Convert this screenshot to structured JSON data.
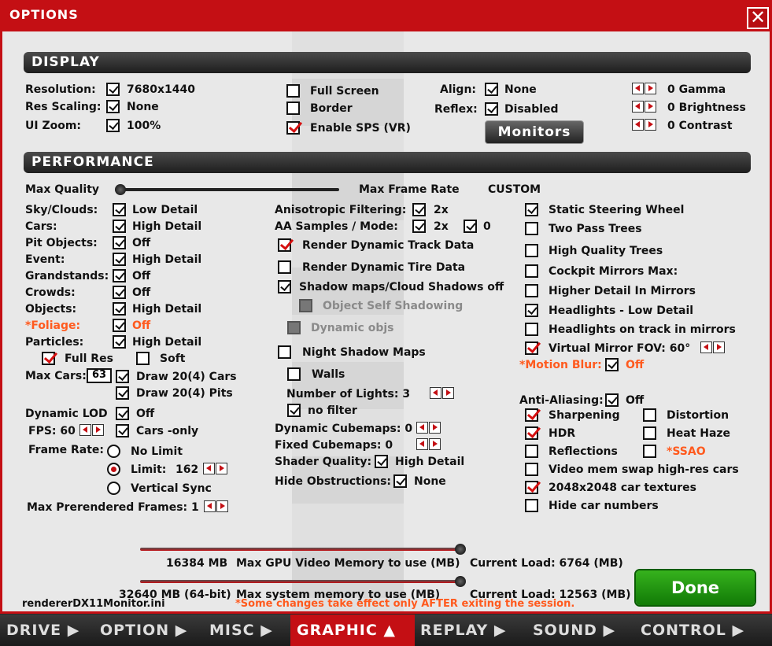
{
  "window": {
    "title": "OPTIONS",
    "close": "✕"
  },
  "display": {
    "header": "DISPLAY",
    "resolution_label": "Resolution:",
    "resolution_value": "7680x1440",
    "res_scaling_label": "Res Scaling:",
    "res_scaling_value": "None",
    "ui_zoom_label": "UI Zoom:",
    "ui_zoom_value": "100%",
    "full_screen": "Full Screen",
    "border": "Border",
    "enable_sps": "Enable SPS (VR)",
    "align_label": "Align:",
    "align_value": "None",
    "reflex_label": "Reflex:",
    "reflex_value": "Disabled",
    "monitors_button": "Monitors",
    "gamma": "0  Gamma",
    "brightness": "0  Brightness",
    "contrast": "0  Contrast"
  },
  "performance": {
    "header": "PERFORMANCE",
    "max_quality": "Max Quality",
    "max_frame_rate": "Max Frame Rate",
    "custom": "CUSTOM",
    "left": [
      {
        "label": "Sky/Clouds:",
        "value": "Low Detail"
      },
      {
        "label": "Cars:",
        "value": "High Detail"
      },
      {
        "label": "Pit Objects:",
        "value": "Off"
      },
      {
        "label": "Event:",
        "value": "High Detail"
      },
      {
        "label": "Grandstands:",
        "value": "Off"
      },
      {
        "label": "Crowds:",
        "value": "Off"
      },
      {
        "label": "Objects:",
        "value": "High Detail"
      },
      {
        "label": "*Foliage:",
        "value": "Off"
      },
      {
        "label": "Particles:",
        "value": "High Detail"
      }
    ],
    "full_res": "Full Res",
    "soft": "Soft",
    "max_cars_label": "Max Cars:",
    "max_cars_value": "63",
    "draw_cars": "Draw 20(4) Cars",
    "draw_pits": "Draw 20(4) Pits",
    "dynamic_lod_label": "Dynamic LOD",
    "dynamic_lod_value": "Off",
    "fps_label": "FPS: 60",
    "cars_only": "Cars -only",
    "frame_rate_label": "Frame Rate:",
    "no_limit": "No Limit",
    "limit_label": "Limit:",
    "limit_value": "162",
    "vertical_sync": "Vertical Sync",
    "max_prerendered": "Max Prerendered Frames: 1",
    "aniso_label": "Anisotropic Filtering:",
    "aniso_value": "2x",
    "aa_label": "AA Samples / Mode:",
    "aa_value": "2x",
    "aa_mode": "0",
    "render_track": "Render Dynamic Track Data",
    "render_tire": "Render Dynamic Tire Data",
    "shadow_maps": "Shadow maps/Cloud Shadows off",
    "object_self": "Object Self Shadowing",
    "dynamic_objs": "Dynamic objs",
    "night_shadow": "Night Shadow Maps",
    "walls": "Walls",
    "num_lights": "Number of Lights: 3",
    "no_filter": "no filter",
    "dyn_cubemaps": "Dynamic Cubemaps: 0",
    "fixed_cubemaps": "Fixed Cubemaps: 0",
    "shader_label": "Shader Quality:",
    "shader_value": "High Detail",
    "hide_obs_label": "Hide Obstructions:",
    "hide_obs_value": "None",
    "static_steering": "Static Steering Wheel",
    "two_pass": "Two Pass Trees",
    "hq_trees": "High Quality Trees",
    "cockpit_mirrors": "Cockpit Mirrors  Max:",
    "higher_detail": "Higher Detail In Mirrors",
    "headlights_low": "Headlights - Low Detail",
    "headlights_track": "Headlights on track in mirrors",
    "virtual_mirror": "Virtual Mirror  FOV:  60°",
    "motion_blur_label": "*Motion Blur:",
    "motion_blur_value": "Off",
    "aa2_label": "Anti-Aliasing:",
    "aa2_value": "Off",
    "sharpening": "Sharpening",
    "distortion": "Distortion",
    "hdr": "HDR",
    "heat_haze": "Heat Haze",
    "reflections": "Reflections",
    "ssao": "*SSAO",
    "video_mem_swap": "Video mem swap high-res cars",
    "car_textures": "2048x2048 car textures",
    "hide_car_numbers": "Hide car numbers"
  },
  "memory": {
    "gpu_value": "16384 MB",
    "gpu_label": "Max GPU Video Memory to use (MB)",
    "gpu_load": "Current Load: 6764 (MB)",
    "sys_value": "32640 MB (64-bit)",
    "sys_label": "Max system memory to use (MB)",
    "sys_load": "Current Load: 12563 (MB)"
  },
  "footer": {
    "ini_file": "rendererDX11Monitor.ini",
    "notice": "*Some changes take effect only AFTER exiting the session.",
    "done_button": "Done"
  },
  "tabs": [
    "DRIVE ▶",
    "OPTION ▶",
    "MISC ▶",
    "GRAPHIC ▲",
    "REPLAY ▶",
    "SOUND ▶",
    "CONTROL ▶"
  ],
  "active_tab": "GRAPHIC",
  "colors": {
    "frame": "#c40f14",
    "panel": "#e8e8e8",
    "orange": "#ff5a1e",
    "done": "#1f9a12"
  }
}
